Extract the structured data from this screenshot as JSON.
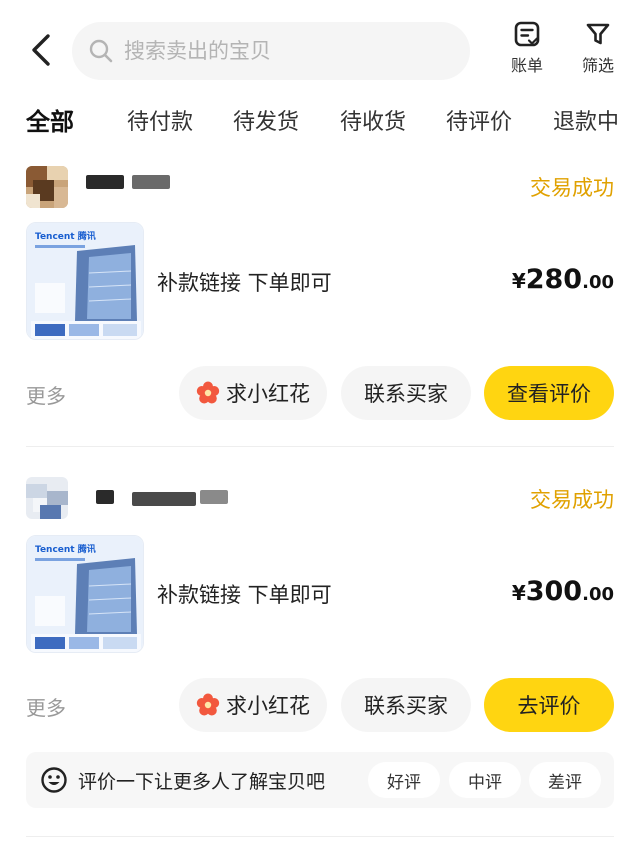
{
  "header": {
    "search_placeholder": "搜索卖出的宝贝",
    "actions": [
      {
        "label": "账单",
        "icon": "bill-icon"
      },
      {
        "label": "筛选",
        "icon": "filter-icon"
      }
    ]
  },
  "tabs": [
    {
      "label": "全部",
      "active": true
    },
    {
      "label": "待付款",
      "active": false
    },
    {
      "label": "待发货",
      "active": false
    },
    {
      "label": "待收货",
      "active": false
    },
    {
      "label": "待评价",
      "active": false
    },
    {
      "label": "退款中",
      "active": false
    }
  ],
  "orders": [
    {
      "status": "交易成功",
      "title": "补款链接 下单即可",
      "price_yen": "¥",
      "price_int": "280",
      "price_dec": ".00",
      "more_label": "更多",
      "btn_flower": "求小红花",
      "btn_contact": "联系买家",
      "btn_primary": "查看评价"
    },
    {
      "status": "交易成功",
      "title": "补款链接 下单即可",
      "price_yen": "¥",
      "price_int": "300",
      "price_dec": ".00",
      "more_label": "更多",
      "btn_flower": "求小红花",
      "btn_contact": "联系买家",
      "btn_primary": "去评价"
    }
  ],
  "review_prompt": {
    "text": "评价一下让更多人了解宝贝吧",
    "good": "好评",
    "medium": "中评",
    "bad": "差评"
  },
  "thumbnail": {
    "brand": "Tencent 腾讯"
  },
  "colors": {
    "accent_yellow": "#ffd511",
    "status_orange": "#e0a100"
  }
}
